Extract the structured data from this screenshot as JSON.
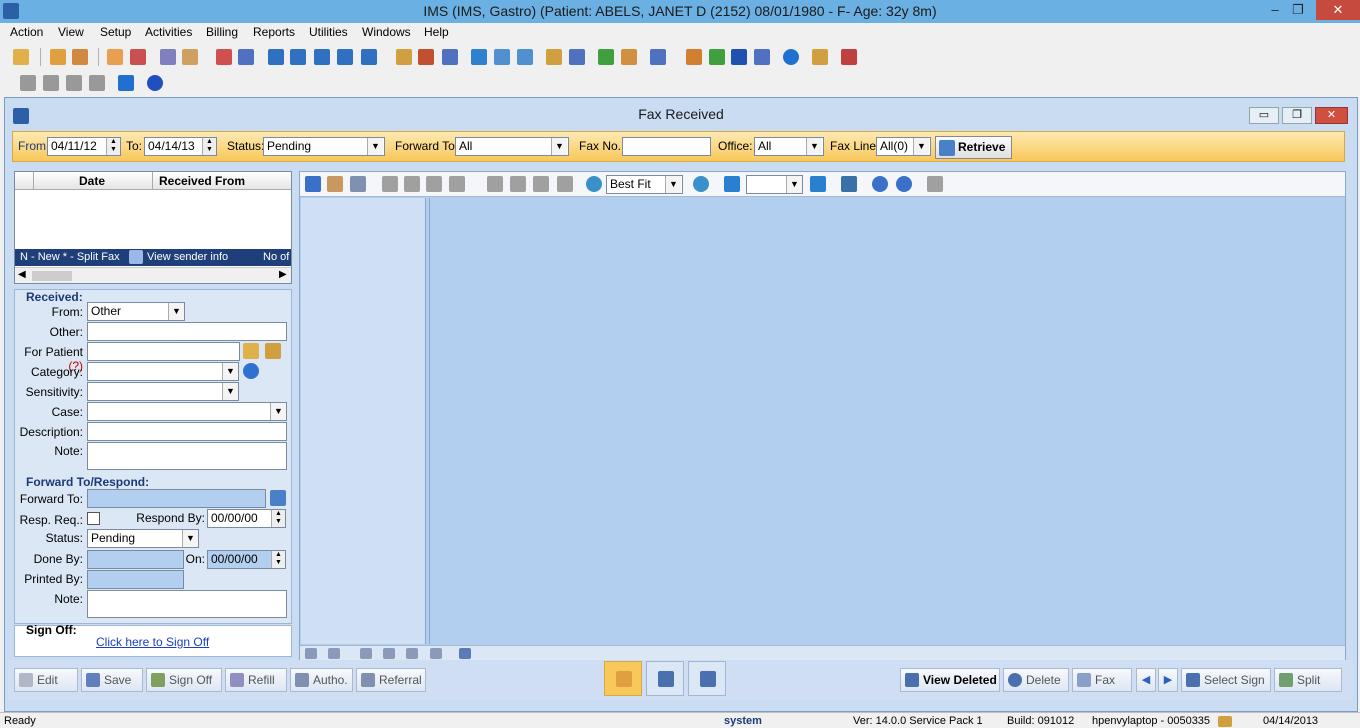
{
  "window": {
    "title": "IMS (IMS, Gastro)     (Patient: ABELS, JANET  D (2152) 08/01/1980 - F- Age: 32y 8m)",
    "minimize": "‒",
    "restore": "❐",
    "close": "✕"
  },
  "menu": [
    "Action",
    "View",
    "Setup",
    "Activities",
    "Billing",
    "Reports",
    "Utilities",
    "Windows",
    "Help"
  ],
  "child": {
    "title": "Fax Received"
  },
  "filter": {
    "from_label": "From:",
    "from_value": "04/11/12",
    "to_label": "To:",
    "to_value": "04/14/13",
    "status_label": "Status:",
    "status_value": "Pending",
    "forward_label": "Forward To:",
    "forward_value": "All",
    "faxno_label": "Fax No.:",
    "faxno_value": "",
    "office_label": "Office:",
    "office_value": "All",
    "faxline_label": "Fax Line:",
    "faxline_value": "All(0)",
    "retrieve_label": "Retrieve"
  },
  "grid": {
    "columns": [
      "Date",
      "Received From"
    ],
    "footer_new": "N - New  * - Split Fax",
    "footer_sender": "View sender info",
    "footer_right": "No of"
  },
  "received": {
    "section": "Received:",
    "from_label": "From:",
    "from_value": "Other",
    "other_label": "Other:",
    "patient_label": "For Patient",
    "patient_hint": "(?)",
    "category_label": "Category:",
    "sensitivity_label": "Sensitivity:",
    "case_label": "Case:",
    "description_label": "Description:",
    "note_label": "Note:"
  },
  "forward": {
    "section": "Forward To/Respond:",
    "to_label": "Forward To:",
    "respreq_label": "Resp. Req.:",
    "respondby_label": "Respond By:",
    "respondby_value": "00/00/00",
    "status_label": "Status:",
    "status_value": "Pending",
    "doneby_label": "Done By:",
    "on_label": "On:",
    "on_value": "00/00/00",
    "printedby_label": "Printed By:",
    "note_label": "Note:"
  },
  "signoff": {
    "section": "Sign Off:",
    "link": "Click here to Sign Off"
  },
  "viewer": {
    "zoom_value": "Best Fit"
  },
  "buttons": {
    "edit": "Edit",
    "save": "Save",
    "signoff": "Sign Off",
    "refill": "Refill",
    "autho": "Autho.",
    "referral": "Referral",
    "view_deleted": "View Deleted",
    "delete": "Delete",
    "fax": "Fax",
    "select_sign": "Select Sign",
    "split": "Split"
  },
  "status": {
    "ready": "Ready",
    "user": "system",
    "version": "Ver: 14.0.0 Service Pack 1",
    "build": "Build: 091012",
    "machine": "hpenvylaptop - 0050335",
    "date": "04/14/2013"
  },
  "colors": {
    "titlebar": "#6bb0e3",
    "filterbar": "#f8c85a",
    "viewer": "#b3cff0",
    "grid_footer": "#1f3f7a"
  }
}
